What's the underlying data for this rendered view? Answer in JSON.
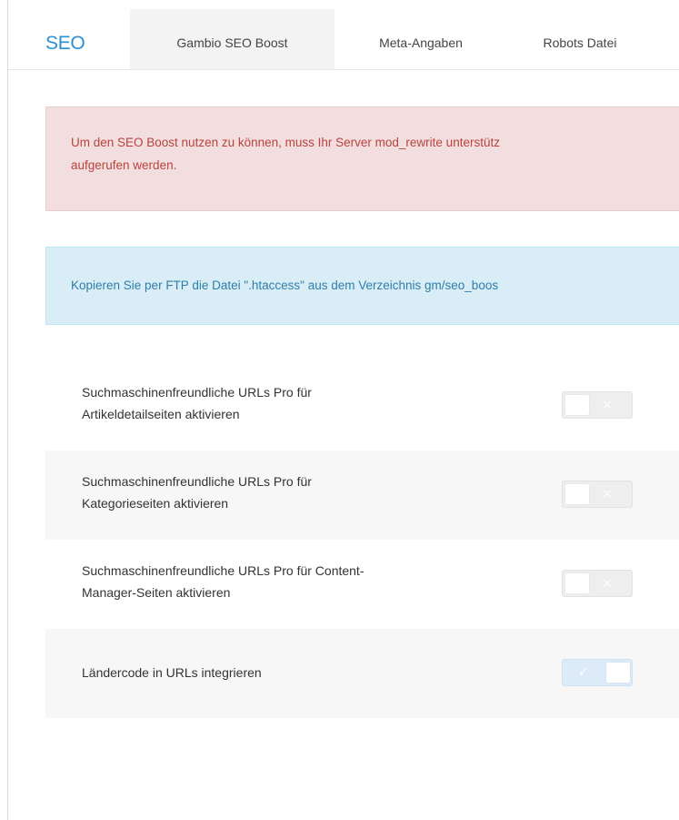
{
  "header": {
    "title": "SEO",
    "tabs": [
      {
        "label": "Gambio SEO Boost",
        "active": true
      },
      {
        "label": "Meta-Angaben",
        "active": false
      },
      {
        "label": "Robots Datei",
        "active": false
      }
    ]
  },
  "alerts": {
    "danger_line1": "Um den SEO Boost nutzen zu können, muss Ihr Server mod_rewrite unterstütz",
    "danger_line2": "aufgerufen werden.",
    "info_text": "Kopieren Sie per FTP die Datei \".htaccess\" aus dem Verzeichnis gm/seo_boos"
  },
  "settings": [
    {
      "line1": "Suchmaschinenfreundliche URLs Pro für",
      "line2": "Artikeldetailseiten aktivieren",
      "enabled": false,
      "glyph": "×"
    },
    {
      "line1": "Suchmaschinenfreundliche URLs Pro für",
      "line2": "Kategorieseiten aktivieren",
      "enabled": false,
      "glyph": "×"
    },
    {
      "line1": "Suchmaschinenfreundliche URLs Pro für Content-",
      "line2": "Manager-Seiten aktivieren",
      "enabled": false,
      "glyph": "×"
    },
    {
      "line1": "Ländercode in URLs integrieren",
      "line2": "",
      "enabled": true,
      "glyph": "✓"
    }
  ],
  "colors": {
    "brand": "#2b8fd0",
    "danger_bg": "#f2dede",
    "danger_text": "#b8433f",
    "info_bg": "#d9edf7",
    "info_text": "#2f7ea8",
    "toggle_on": "#dcebf7",
    "toggle_off": "#eeeeee"
  }
}
